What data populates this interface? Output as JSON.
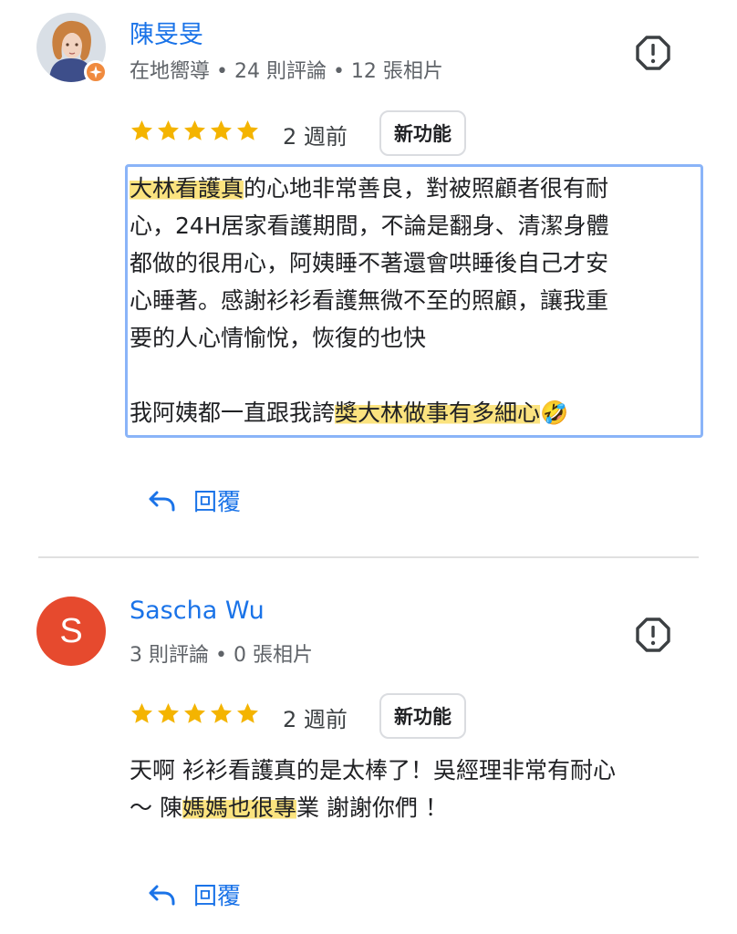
{
  "reviews": [
    {
      "author": "陳旻旻",
      "meta": "在地嚮導 • 24 則評論 • 12 張相片",
      "rating": 5,
      "time": "2 週前",
      "badge": "新功能",
      "text": {
        "p1_hl1": "大林看護真",
        "p1_rest": "的心地非常善良，對被照顧者很有耐\n心，24H居家看護期間，不論是翻身、清潔身體\n都做的很用心，阿姨睡不著還會哄睡後自己才安\n心睡著。感謝衫衫看護無微不至的照顧，讓我重\n要的人心情愉悅，恢復的也快\n\n我阿姨都一直跟我誇",
        "p1_hl2": "獎大林做事有多細心",
        "emoji": "🤣"
      },
      "reply_label": "回覆"
    },
    {
      "author": "Sascha Wu",
      "avatar_letter": "S",
      "meta": "3 則評論 • 0 張相片",
      "rating": 5,
      "time": "2 週前",
      "badge": "新功能",
      "text": {
        "part1": "天啊 衫衫看護真的是太棒了！吳經理非常有耐心\n～ 陳",
        "hl": "媽媽也很專",
        "part2": "業 謝謝你們 ！"
      },
      "reply_label": "回覆"
    }
  ],
  "colors": {
    "link": "#1a73e8",
    "star": "#f4b400",
    "highlight": "#fbe37f",
    "letter_avatar": "#e64a2e",
    "guide_badge": "#f08a3e",
    "selection_border": "#8ab4f8"
  },
  "icons": [
    "local-guide-badge-icon",
    "report-flag-icon",
    "star-icon",
    "reply-arrow-icon"
  ]
}
